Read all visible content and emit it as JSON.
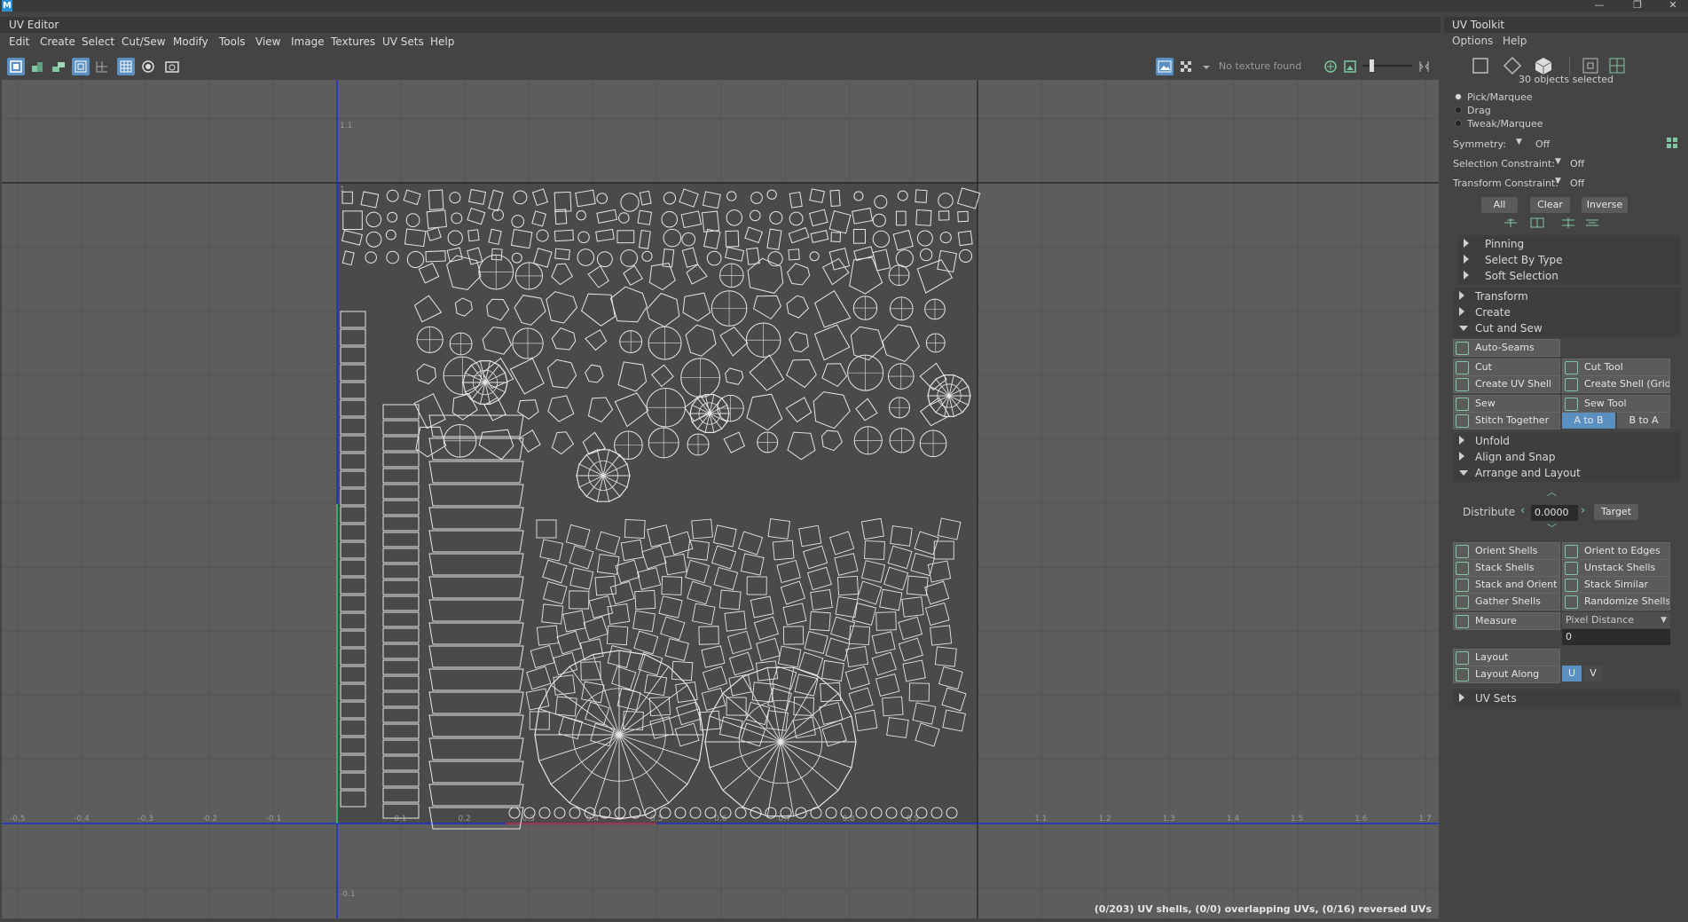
{
  "window": {
    "minimize": "—",
    "restore": "❐",
    "close": "✕",
    "logo": "M"
  },
  "uv_editor": {
    "title": "UV Editor",
    "menu": [
      "Edit",
      "Create",
      "Select",
      "Cut/Sew",
      "Modify",
      "Tools",
      "View",
      "Image",
      "Textures",
      "UV Sets",
      "Help"
    ],
    "texture_status": "No texture found",
    "axis_x_labels": [
      "-0.5",
      "-0.4",
      "-0.3",
      "-0.2",
      "-0.1",
      "0.1",
      "0.2",
      "0.3",
      "0.4",
      "0.5",
      "0.6",
      "0.7",
      "0.8",
      "0.9",
      "1.1",
      "1.2",
      "1.3",
      "1.4",
      "1.5",
      "1.6",
      "1.7"
    ],
    "axis_y_labels": [
      "1.1",
      "1",
      "-0.1"
    ],
    "status": "(0/203) UV shells, (0/0) overlapping UVs, (0/16) reversed UVs"
  },
  "toolkit": {
    "title": "UV Toolkit",
    "menu": [
      "Options",
      "Help"
    ],
    "selection_count": "30 objects selected",
    "modes": [
      {
        "label": "Pick/Marquee",
        "selected": true
      },
      {
        "label": "Drag",
        "selected": false
      },
      {
        "label": "Tweak/Marquee",
        "selected": false
      }
    ],
    "symmetry_label": "Symmetry:",
    "symmetry_value": "Off",
    "selection_constraint_label": "Selection Constraint:",
    "selection_constraint_value": "Off",
    "transform_constraint_label": "Transform Constraint:",
    "transform_constraint_value": "Off",
    "select_buttons": [
      "All",
      "Clear",
      "Inverse"
    ],
    "sub_sections": [
      "Pinning",
      "Select By Type",
      "Soft Selection"
    ],
    "sections_top": [
      "Transform",
      "Create"
    ],
    "cut_and_sew": "Cut and Sew",
    "auto_seams": "Auto-Seams",
    "cut": "Cut",
    "cut_tool": "Cut Tool",
    "create_uv_shell": "Create UV Shell",
    "create_shell_grid": "Create Shell (Grid)",
    "sew": "Sew",
    "sew_tool": "Sew Tool",
    "stitch_together": "Stitch Together",
    "a_to_b": "A to B",
    "b_to_a": "B to A",
    "unfold": "Unfold",
    "align_and_snap": "Align and Snap",
    "arrange_and_layout": "Arrange and Layout",
    "distribute_label": "Distribute",
    "distribute_value": "0.0000",
    "target": "Target",
    "orient_shells": "Orient Shells",
    "orient_to_edges": "Orient to Edges",
    "stack_shells": "Stack Shells",
    "unstack_shells": "Unstack Shells",
    "stack_and_orient": "Stack and Orient",
    "stack_similar": "Stack Similar",
    "gather_shells": "Gather Shells",
    "randomize_shells": "Randomize Shells",
    "measure": "Measure",
    "measure_mode": "Pixel Distance",
    "measure_value": "0",
    "layout": "Layout",
    "layout_along": "Layout Along",
    "u": "U",
    "v": "V",
    "uv_sets": "UV Sets"
  },
  "colors": {
    "accent_blue": "#5a8fc0",
    "uv_wire": "#e6e6e6",
    "u_axis": "#0000ff",
    "green_edge": "#37d35a"
  }
}
